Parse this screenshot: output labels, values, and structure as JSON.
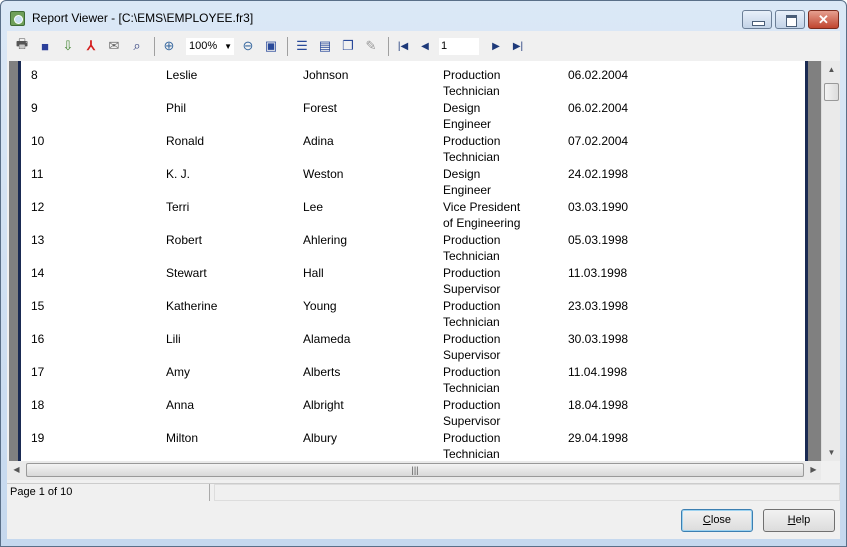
{
  "window": {
    "title": "Report Viewer - [C:\\EMS\\EMPLOYEE.fr3]"
  },
  "toolbar": {
    "zoom_value": "100%",
    "page_number": "1",
    "icons": [
      "print-icon",
      "save-icon",
      "export-icon",
      "pdf-icon",
      "email-icon",
      "find-icon",
      "zoom-in-icon",
      "zoom-out-icon",
      "full-screen-icon",
      "outline-icon",
      "thumbnails-icon",
      "page-setup-icon",
      "edit-icon",
      "first-page-icon",
      "prev-page-icon",
      "next-page-icon",
      "last-page-icon"
    ]
  },
  "report": {
    "rows": [
      {
        "no": "8",
        "first": "Leslie",
        "last": "Johnson",
        "title1": "Production",
        "title2": "Technician",
        "date": "06.02.2004"
      },
      {
        "no": "9",
        "first": "Phil",
        "last": "Forest",
        "title1": "Design",
        "title2": "Engineer",
        "date": "06.02.2004"
      },
      {
        "no": "10",
        "first": "Ronald",
        "last": "Adina",
        "title1": "Production",
        "title2": "Technician",
        "date": "07.02.2004"
      },
      {
        "no": "11",
        "first": "K. J.",
        "last": "Weston",
        "title1": "Design",
        "title2": "Engineer",
        "date": "24.02.1998"
      },
      {
        "no": "12",
        "first": "Terri",
        "last": "Lee",
        "title1": "Vice President",
        "title2": "of Engineering",
        "date": "03.03.1990"
      },
      {
        "no": "13",
        "first": "Robert",
        "last": "Ahlering",
        "title1": "Production",
        "title2": "Technician",
        "date": "05.03.1998"
      },
      {
        "no": "14",
        "first": "Stewart",
        "last": "Hall",
        "title1": "Production",
        "title2": "Supervisor",
        "date": "11.03.1998"
      },
      {
        "no": "15",
        "first": "Katherine",
        "last": "Young",
        "title1": "Production",
        "title2": "Technician",
        "date": "23.03.1998"
      },
      {
        "no": "16",
        "first": "Lili",
        "last": "Alameda",
        "title1": "Production",
        "title2": "Supervisor",
        "date": "30.03.1998"
      },
      {
        "no": "17",
        "first": "Amy",
        "last": "Alberts",
        "title1": "Production",
        "title2": "Technician",
        "date": "11.04.1998"
      },
      {
        "no": "18",
        "first": "Anna",
        "last": "Albright",
        "title1": "Production",
        "title2": "Supervisor",
        "date": "18.04.1998"
      },
      {
        "no": "19",
        "first": "Milton",
        "last": "Albury",
        "title1": "Production",
        "title2": "Technician",
        "date": "29.04.1998"
      }
    ]
  },
  "status": {
    "page_info": "Page 1 of 10",
    "message": ""
  },
  "buttons": {
    "close_label": "Close",
    "close_accel": "C",
    "close_rest": "lose",
    "help_label": "Help",
    "help_accel": "H",
    "help_rest": "elp"
  }
}
